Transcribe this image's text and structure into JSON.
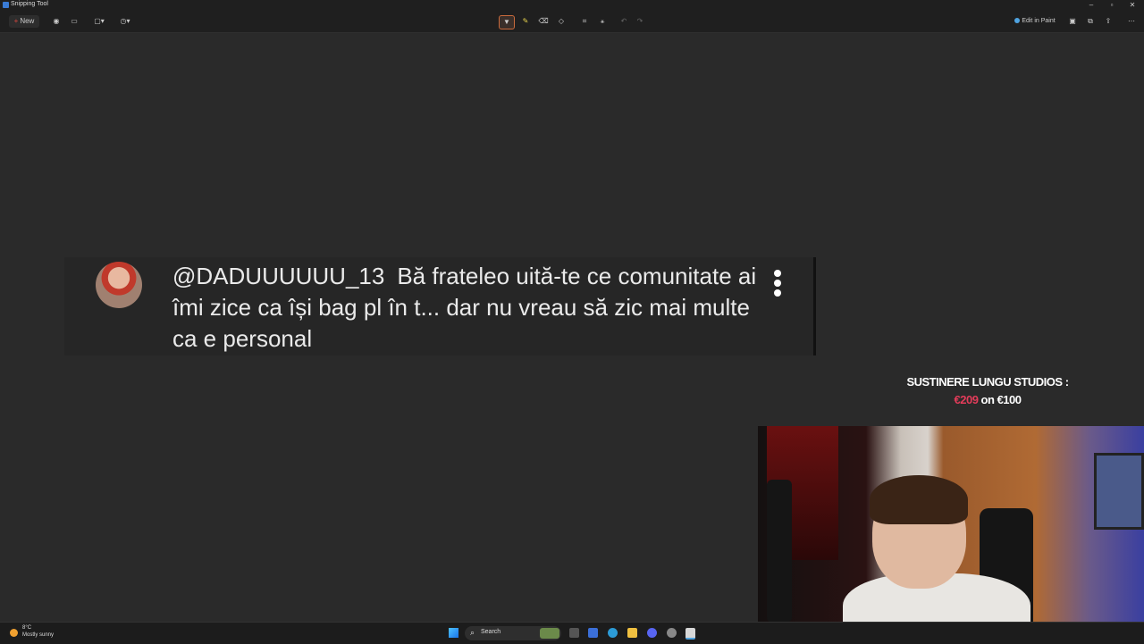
{
  "window": {
    "title": "Snipping Tool",
    "controls": [
      "–",
      "▫",
      "✕"
    ]
  },
  "toolbar": {
    "new_label": "New",
    "edit_in_paint_label": "Edit in Paint"
  },
  "comment": {
    "handle": "@DADUUUUUU_13",
    "text": "Bă frateleo uită-te ce comunitate ai îmi zice ca își bag pl în t... dar nu vreau să zic mai multe ca e personal"
  },
  "support": {
    "title": "SUSTINERE LUNGU STUDIOS :",
    "current": "€209",
    "separator": "on",
    "goal": "€100"
  },
  "taskbar": {
    "weather_temp": "8°C",
    "weather_desc": "Mostly sunny",
    "search_label": "Search"
  },
  "colors": {
    "accent": "#e0483e",
    "support_amount": "#e33c5a",
    "background": "#2a2a2a"
  },
  "icons": [
    "snip-mode-icon",
    "video-icon",
    "rectangle-icon",
    "delay-icon",
    "highlighter-icon",
    "pen-icon",
    "eraser-icon",
    "shapes-icon",
    "crop-icon",
    "ocr-icon",
    "undo-icon",
    "redo-icon",
    "save-icon",
    "copy-icon",
    "share-icon",
    "more-icon"
  ]
}
